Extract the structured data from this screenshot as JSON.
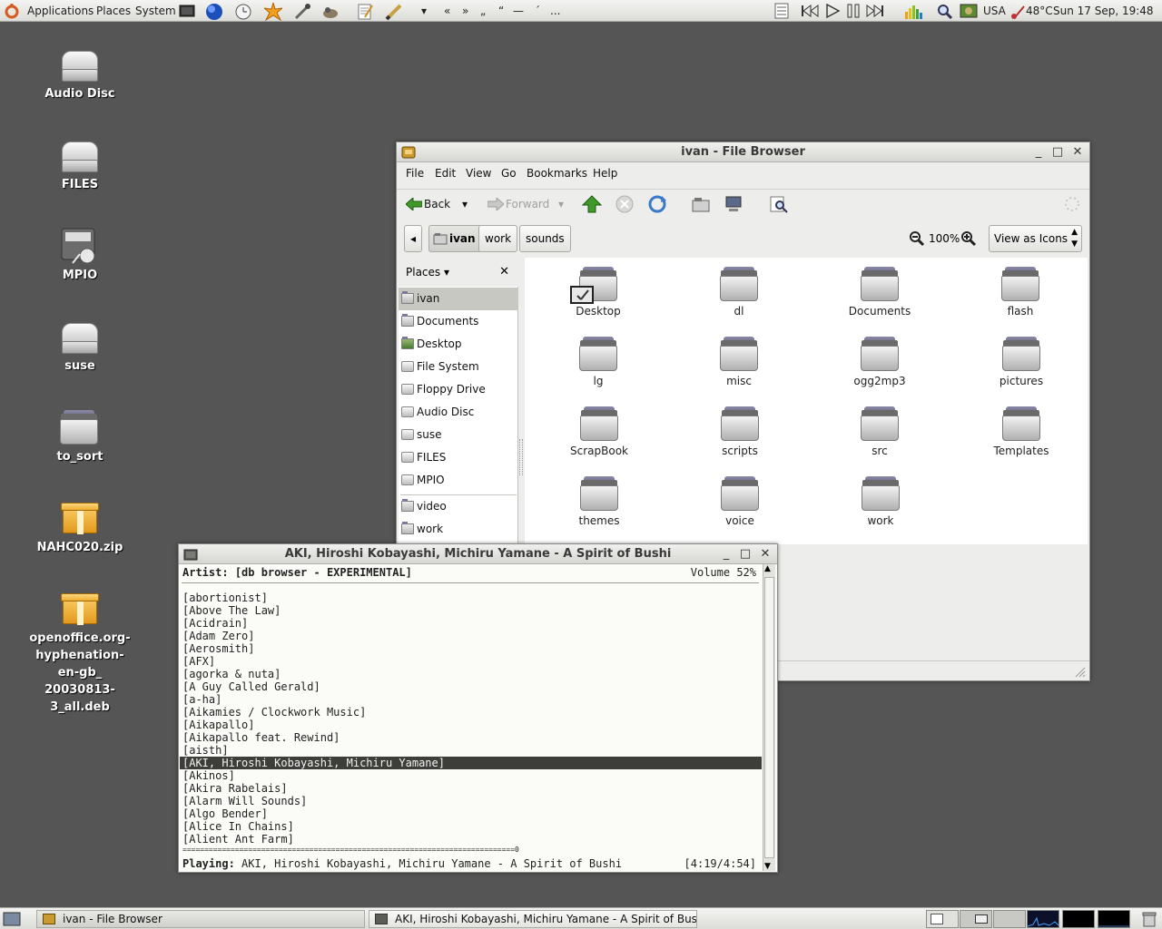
{
  "top_panel": {
    "menus": [
      "Applications",
      "Places",
      "System"
    ],
    "keyboard_layout": "USA",
    "temperature": "48°C",
    "clock": "Sun 17 Sep, 19:48",
    "quick_chars": [
      "«",
      "»",
      "„",
      "“",
      "—",
      "´",
      "..."
    ]
  },
  "desktop_icons": [
    {
      "label": "Audio Disc",
      "icon": "audio-disc-icon"
    },
    {
      "label": "FILES",
      "icon": "drive-icon"
    },
    {
      "label": "MPIO",
      "icon": "media-player-icon"
    },
    {
      "label": "suse",
      "icon": "drive-icon"
    },
    {
      "label": "to_sort",
      "icon": "folder-icon"
    },
    {
      "label": "NAHC020.zip",
      "icon": "package-icon"
    },
    {
      "label_lines": [
        "openoffice.org-",
        "hyphenation-en-gb_",
        "20030813-3_all.deb"
      ],
      "icon": "package-icon"
    }
  ],
  "file_browser": {
    "title": "ivan - File Browser",
    "menu": [
      "File",
      "Edit",
      "View",
      "Go",
      "Bookmarks",
      "Help"
    ],
    "toolbar": {
      "back": "Back",
      "forward": "Forward"
    },
    "breadcrumbs": [
      "ivan",
      "work",
      "sounds"
    ],
    "zoom": "100%",
    "view_mode": "View as Icons",
    "sidebar": {
      "header": "Places",
      "items": [
        "ivan",
        "Documents",
        "Desktop",
        "File System",
        "Floppy Drive",
        "Audio Disc",
        "suse",
        "FILES",
        "MPIO"
      ],
      "bookmarks": [
        "video",
        "work"
      ]
    },
    "items": [
      "Desktop",
      "dl",
      "Documents",
      "flash",
      "lg",
      "misc",
      "ogg2mp3",
      "pictures",
      "ScrapBook",
      "scripts",
      "src",
      "Templates",
      "themes",
      "voice",
      "work"
    ]
  },
  "player": {
    "title": "AKI, Hiroshi Kobayashi, Michiru Yamane - A Spirit of Bushi",
    "header_label": "Artist:",
    "header_value": "[db browser - EXPERIMENTAL]",
    "volume": "Volume 52%",
    "artists": [
      "[abortionist]",
      "[Above The Law]",
      "[Acidrain]",
      "[Adam Zero]",
      "[Aerosmith]",
      "[AFX]",
      "[agorka & nuta]",
      "[A Guy Called Gerald]",
      "[a-ha]",
      "[Aikamies / Clockwork Music]",
      "[Aikapallo]",
      "[Aikapallo feat. Rewind]",
      "[aisth]",
      "[AKI, Hiroshi Kobayashi, Michiru Yamane]",
      "[Akinos]",
      "[Akira Rabelais]",
      "[Alarm Will Sounds]",
      "[Algo Bender]",
      "[Alice In Chains]",
      "[Alient Ant Farm]"
    ],
    "selected_index": 13,
    "progress_line": "============================================================================0",
    "playing_label": "Playing:",
    "playing_value": "AKI, Hiroshi Kobayashi, Michiru Yamane - A Spirit of Bushi",
    "time": "[4:19/4:54]"
  },
  "taskbar": {
    "tasks": [
      "ivan - File Browser",
      "AKI, Hiroshi Kobayashi, Michiru Yamane - A Spirit of Bushi"
    ]
  }
}
